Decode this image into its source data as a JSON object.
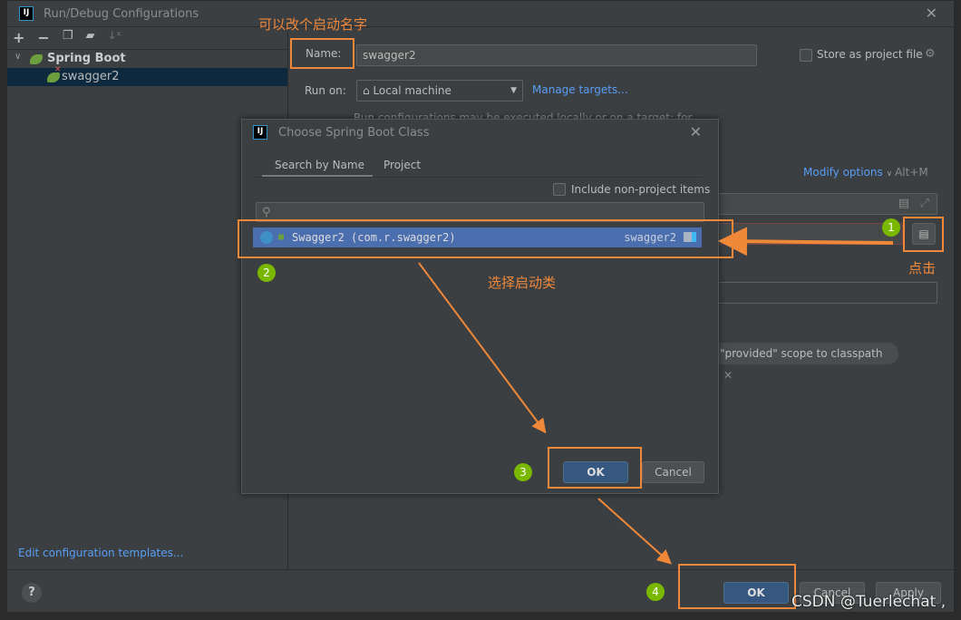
{
  "window": {
    "title": "Run/Debug Configurations",
    "close_icon": "close-icon"
  },
  "toolbar": {
    "icons": [
      "plus-icon",
      "minus-icon",
      "copy-icon",
      "new-folder-icon",
      "sort-icon"
    ]
  },
  "tree": {
    "group": "Spring Boot",
    "item": "swagger2"
  },
  "left_footer": {
    "edit_templates": "Edit configuration templates..."
  },
  "form": {
    "name_label": "Name:",
    "name_value": "swagger2",
    "store_label": "Store as project file",
    "run_on_label": "Run on:",
    "run_on_value": "Local machine",
    "manage_targets": "Manage targets...",
    "run_on_hint": "Run configurations may be executed locally or on a target: for",
    "modify_options": "Modify options",
    "modify_shortcut": "Alt+M",
    "chip_text": "\"provided\" scope to classpath"
  },
  "chooser": {
    "title": "Choose Spring Boot Class",
    "tabs": [
      "Search by Name",
      "Project"
    ],
    "include_label": "Include non-project items",
    "search_value": "",
    "result": {
      "class": "Swagger2 (com.r.swagger2)",
      "module": "swagger2"
    },
    "ok": "OK",
    "cancel": "Cancel"
  },
  "footer": {
    "help": "?",
    "ok": "OK",
    "cancel": "Cancel",
    "apply": "Apply"
  },
  "annotations": {
    "rename_note": "可以改个启动名字",
    "click_note": "点击",
    "choose_note": "选择启动类",
    "steps": [
      "1",
      "2",
      "3",
      "4"
    ],
    "color": "#f0883a",
    "step_color": "#7ab800"
  },
  "watermark": "CSDN @Tuerlechat ,"
}
